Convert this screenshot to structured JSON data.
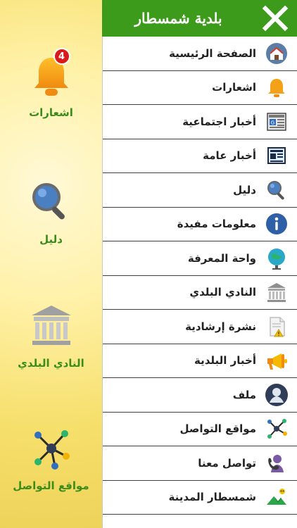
{
  "header": {
    "title": "بلدية شمسطار",
    "close_icon": "close-icon",
    "bar_color": "#3d9b1c"
  },
  "left_panel": {
    "tiles": [
      {
        "label": "اشعارات",
        "icon": "bell-icon",
        "badge": "4"
      },
      {
        "label": "دليل",
        "icon": "search-icon"
      },
      {
        "label": "النادي البلدي",
        "icon": "institution-icon"
      },
      {
        "label": "مواقع التواصل",
        "icon": "network-icon"
      }
    ],
    "label_color": "#3a8d1a"
  },
  "menu": {
    "items": [
      {
        "label": "الصفحة الرئيسية",
        "icon": "home-icon"
      },
      {
        "label": "اشعارات",
        "icon": "bell-icon"
      },
      {
        "label": "أخبار اجتماعية",
        "icon": "newspaper-g-icon"
      },
      {
        "label": "أخبار عامة",
        "icon": "newspaper-icon"
      },
      {
        "label": "دليل",
        "icon": "search-icon"
      },
      {
        "label": "معلومات مفيدة",
        "icon": "info-icon"
      },
      {
        "label": "واحة المعرفة",
        "icon": "globe-icon"
      },
      {
        "label": "النادي البلدي",
        "icon": "institution-icon"
      },
      {
        "label": "نشرة إرشادية",
        "icon": "document-warning-icon"
      },
      {
        "label": "أخبار البلدية",
        "icon": "megaphone-icon"
      },
      {
        "label": "ملف",
        "icon": "profile-icon"
      },
      {
        "label": "مواقع التواصل",
        "icon": "network-icon"
      },
      {
        "label": "تواصل معنا",
        "icon": "contact-icon"
      },
      {
        "label": "شمسطار المدينة",
        "icon": "landscape-icon"
      }
    ]
  }
}
